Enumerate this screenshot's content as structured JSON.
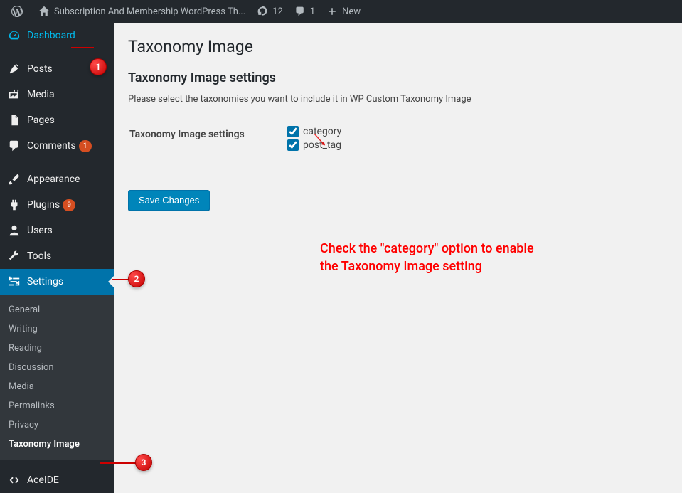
{
  "adminbar": {
    "site_name": "Subscription And Membership WordPress Th...",
    "updates": "12",
    "comments": "1",
    "new_label": "New"
  },
  "sidebar": {
    "dashboard": "Dashboard",
    "posts": "Posts",
    "media": "Media",
    "pages": "Pages",
    "comments": "Comments",
    "comments_count": "1",
    "appearance": "Appearance",
    "plugins": "Plugins",
    "plugins_count": "9",
    "users": "Users",
    "tools": "Tools",
    "settings": "Settings",
    "aceide": "AceIDE",
    "submenu": {
      "general": "General",
      "writing": "Writing",
      "reading": "Reading",
      "discussion": "Discussion",
      "media": "Media",
      "permalinks": "Permalinks",
      "privacy": "Privacy",
      "taxonomy_image": "Taxonomy Image"
    }
  },
  "page": {
    "title": "Taxonomy Image",
    "heading": "Taxonomy Image settings",
    "description": "Please select the taxonomies you want to include it in WP Custom Taxonomy Image",
    "row_label": "Taxonomy Image settings",
    "options": {
      "category": {
        "label": "category",
        "checked": true
      },
      "post_tag": {
        "label": "post_tag",
        "checked": true
      }
    },
    "save_button": "Save Changes"
  },
  "annotations": {
    "m1": "1",
    "m2": "2",
    "m3": "3",
    "text": "Check the \"category\" option to enable the Taxonomy Image setting"
  }
}
